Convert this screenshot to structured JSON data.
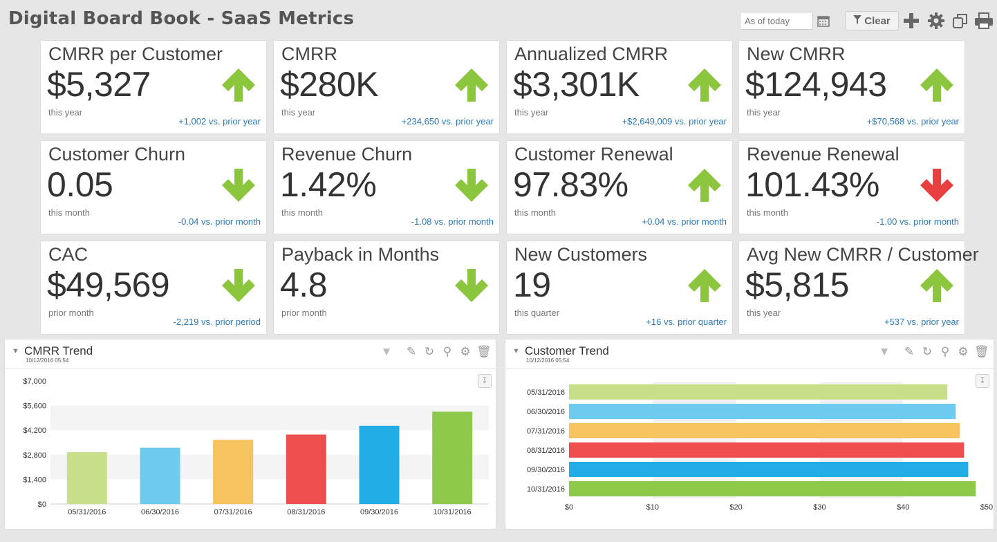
{
  "header": {
    "title": "Digital Board Book - SaaS Metrics",
    "date_placeholder": "As of today",
    "clear_label": "Clear"
  },
  "cards": [
    {
      "title": "CMRR per Customer",
      "value": "$5,327",
      "period": "this year",
      "compare": "+1,002 vs. prior year",
      "direction": "up",
      "color": "#8cc63f"
    },
    {
      "title": "CMRR",
      "value": "$280K",
      "period": "this year",
      "compare": "+234,650 vs. prior year",
      "direction": "up",
      "color": "#8cc63f"
    },
    {
      "title": "Annualized CMRR",
      "value": "$3,301K",
      "period": "this year",
      "compare": "+$2,649,009 vs. prior year",
      "direction": "up",
      "color": "#8cc63f"
    },
    {
      "title": "New CMRR",
      "value": "$124,943",
      "period": "this year",
      "compare": "+$70,568 vs. prior year",
      "direction": "up",
      "color": "#8cc63f"
    },
    {
      "title": "Customer Churn",
      "value": "0.05",
      "period": "this month",
      "compare": "-0.04 vs. prior month",
      "direction": "down",
      "color": "#8cc63f"
    },
    {
      "title": "Revenue Churn",
      "value": "1.42%",
      "period": "this month",
      "compare": "-1.08 vs. prior month",
      "direction": "down",
      "color": "#8cc63f"
    },
    {
      "title": "Customer Renewal",
      "value": "97.83%",
      "period": "this month",
      "compare": "+0.04 vs. prior month",
      "direction": "up",
      "color": "#8cc63f"
    },
    {
      "title": "Revenue Renewal",
      "value": "101.43%",
      "period": "this month",
      "compare": "-1.00 vs. prior month",
      "direction": "down",
      "color": "#e8403e"
    },
    {
      "title": "CAC",
      "value": "$49,569",
      "period": "prior month",
      "compare": "-2,219 vs. prior period",
      "direction": "down",
      "color": "#8cc63f"
    },
    {
      "title": "Payback in Months",
      "value": "4.8",
      "period": "prior month",
      "compare": "",
      "direction": "down",
      "color": "#8cc63f"
    },
    {
      "title": "New Customers",
      "value": "19",
      "period": "this quarter",
      "compare": "+16 vs. prior quarter",
      "direction": "up",
      "color": "#8cc63f"
    },
    {
      "title": "Avg New CMRR / Customer",
      "value": "$5,815",
      "period": "this year",
      "compare": "+537 vs. prior year",
      "direction": "up",
      "color": "#8cc63f"
    }
  ],
  "panels": {
    "cmrr": {
      "title": "CMRR Trend",
      "stamp": "10/12/2016 05:54"
    },
    "customer": {
      "title": "Customer Trend",
      "stamp": "10/12/2016 05:54"
    }
  },
  "chart_data": [
    {
      "type": "bar",
      "title": "CMRR Trend",
      "categories": [
        "05/31/2016",
        "06/30/2016",
        "07/31/2016",
        "08/31/2016",
        "09/30/2016",
        "10/31/2016"
      ],
      "values": [
        2950,
        3200,
        3650,
        3950,
        4450,
        5250
      ],
      "colors": [
        "#c9e08a",
        "#6ccbef",
        "#f7c35e",
        "#ee4e4e",
        "#22ade6",
        "#8fc94b"
      ],
      "ylim": [
        0,
        7000
      ],
      "yticks": [
        "$0",
        "$1,400",
        "$2,800",
        "$4,200",
        "$5,600",
        "$7,000"
      ]
    },
    {
      "type": "bar",
      "orientation": "horizontal",
      "title": "Customer Trend",
      "categories": [
        "05/31/2016",
        "06/30/2016",
        "07/31/2016",
        "08/31/2016",
        "09/30/2016",
        "10/31/2016"
      ],
      "values": [
        45.3,
        46.3,
        46.8,
        47.3,
        47.8,
        48.7
      ],
      "colors": [
        "#c9e08a",
        "#6ccbef",
        "#f7c35e",
        "#ee4e4e",
        "#22ade6",
        "#8fc94b"
      ],
      "xlim": [
        0,
        50
      ],
      "xticks": [
        "$0",
        "$10",
        "$20",
        "$30",
        "$40",
        "$50"
      ]
    }
  ]
}
